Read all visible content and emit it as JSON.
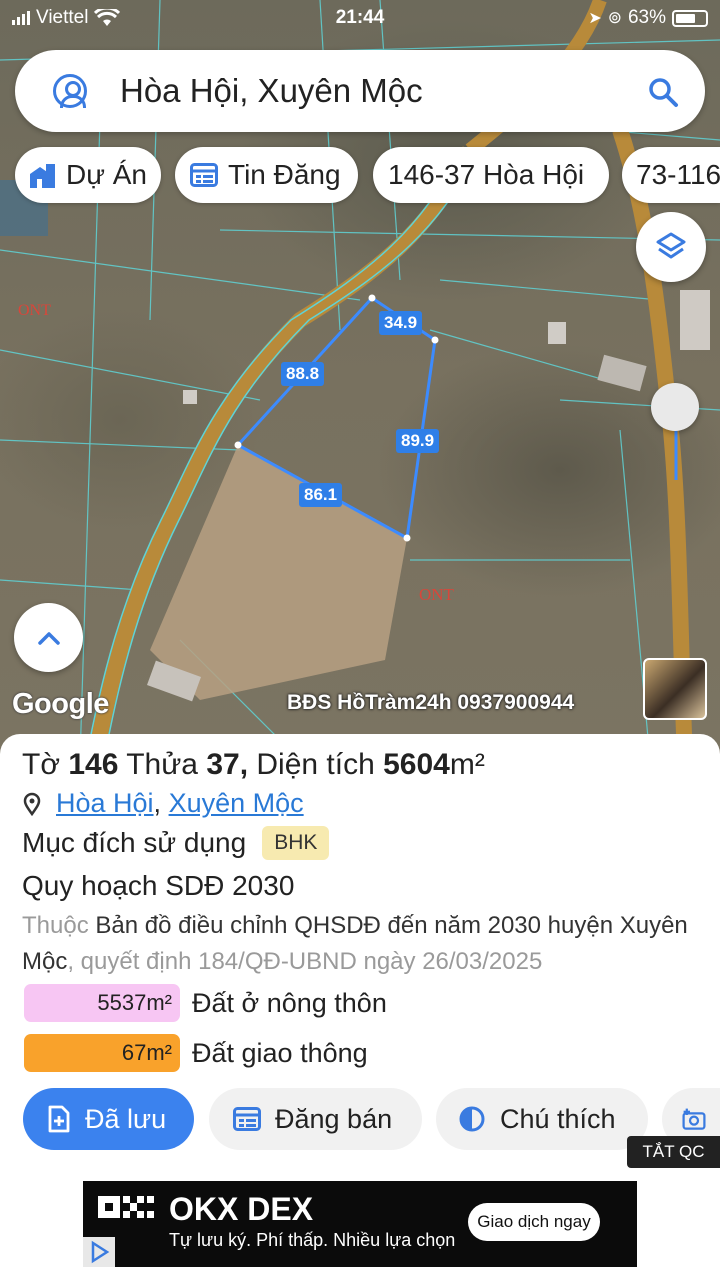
{
  "status": {
    "carrier": "Viettel",
    "time": "21:44",
    "battery": "63%"
  },
  "search": {
    "query": "Hòa Hội, Xuyên Mộc"
  },
  "chips": [
    {
      "label": "Dự Án",
      "icon": "building-icon"
    },
    {
      "label": "Tin Đăng",
      "icon": "listing-icon"
    },
    {
      "label": "146-37 Hòa Hội"
    },
    {
      "label": "73-116"
    }
  ],
  "map": {
    "zone_label_1": "ONT",
    "zone_label_2": "ONT",
    "measurements": [
      "34.9",
      "88.8",
      "89.9",
      "86.1"
    ],
    "google": "Google",
    "watermark": "BĐS HồTràm24h 0937900944"
  },
  "parcel": {
    "sheet_prefix": "Tờ",
    "sheet": "146",
    "plot_prefix": "Thửa",
    "plot": "37,",
    "area_prefix": "Diện tích",
    "area": "5604",
    "area_unit": "m²",
    "ward": "Hòa Hội",
    "district": "Xuyên Mộc",
    "purpose_label": "Mục đích sử dụng",
    "purpose_code": "BHK",
    "plan_label": "Quy hoạch SDĐ 2030",
    "desc_prefix": "Thuộc",
    "desc_map": "Bản đồ điều chỉnh QHSDĐ đến năm 2030 huyện Xuyên Mộc",
    "desc_decision": ", quyết định 184/QĐ-UBND ngày 26/03/2025"
  },
  "land_uses": [
    {
      "area": "5537m²",
      "name": "Đất ở nông thôn",
      "color": "#f7c6f3"
    },
    {
      "area": "67m²",
      "name": "Đất giao thông",
      "color": "#f9a22b"
    }
  ],
  "actions": {
    "saved": "Đã lưu",
    "post_sale": "Đăng bán",
    "legend": "Chú thích"
  },
  "ads_toggle": "TẮT QC",
  "ad": {
    "brand": "OKX DEX",
    "tagline": "Tự lưu ký. Phí thấp. Nhiều lựa chọn",
    "cta": "Giao dịch ngay"
  }
}
